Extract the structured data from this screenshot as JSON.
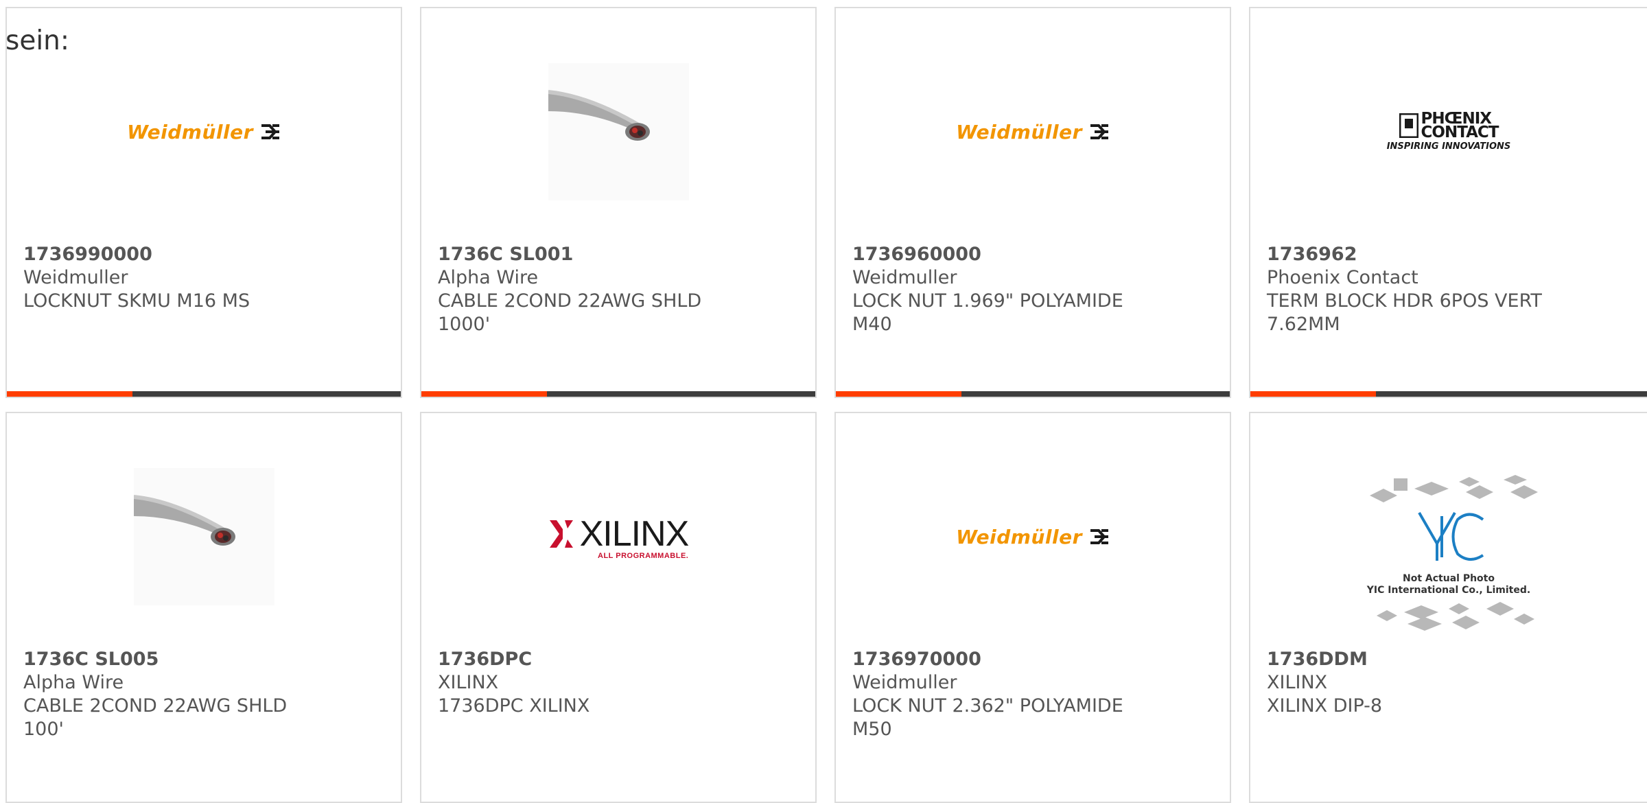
{
  "intro_text": "sein:",
  "accent_color": "#ff3d00",
  "bar_color": "#3d3d3d",
  "logos": {
    "weidmuller": "Weidmüller",
    "xilinx_word": "XILINX",
    "xilinx_tag": "ALL PROGRAMMABLE.",
    "phoenix_line1": "PHŒNIX",
    "phoenix_line2": "CONTACT",
    "phoenix_tag": "INSPIRING INNOVATIONS",
    "yic_line1": "Not Actual Photo",
    "yic_line2": "YIC International Co., Limited."
  },
  "products": [
    {
      "part": "1736990000",
      "brand": "Weidmuller",
      "description": "LOCKNUT SKMU M16 MS",
      "image": "weidmuller-logo"
    },
    {
      "part": "1736C SL001",
      "brand": "Alpha Wire",
      "description": "CABLE 2COND 22AWG SHLD 1000'",
      "image": "cable-photo"
    },
    {
      "part": "1736960000",
      "brand": "Weidmuller",
      "description": "LOCK NUT 1.969\" POLYAMIDE M40",
      "image": "weidmuller-logo"
    },
    {
      "part": "1736962",
      "brand": "Phoenix Contact",
      "description": "TERM BLOCK HDR 6POS VERT 7.62MM",
      "image": "phoenix-contact-logo"
    },
    {
      "part": "1736C SL005",
      "brand": "Alpha Wire",
      "description": "CABLE 2COND 22AWG SHLD 100'",
      "image": "cable-photo"
    },
    {
      "part": "1736DPC",
      "brand": "XILINX",
      "description": "1736DPC XILINX",
      "image": "xilinx-logo"
    },
    {
      "part": "1736970000",
      "brand": "Weidmuller",
      "description": "LOCK NUT 2.362\" POLYAMIDE M50",
      "image": "weidmuller-logo"
    },
    {
      "part": "1736DDM",
      "brand": "XILINX",
      "description": "XILINX DIP-8",
      "image": "yic-placeholder"
    }
  ]
}
